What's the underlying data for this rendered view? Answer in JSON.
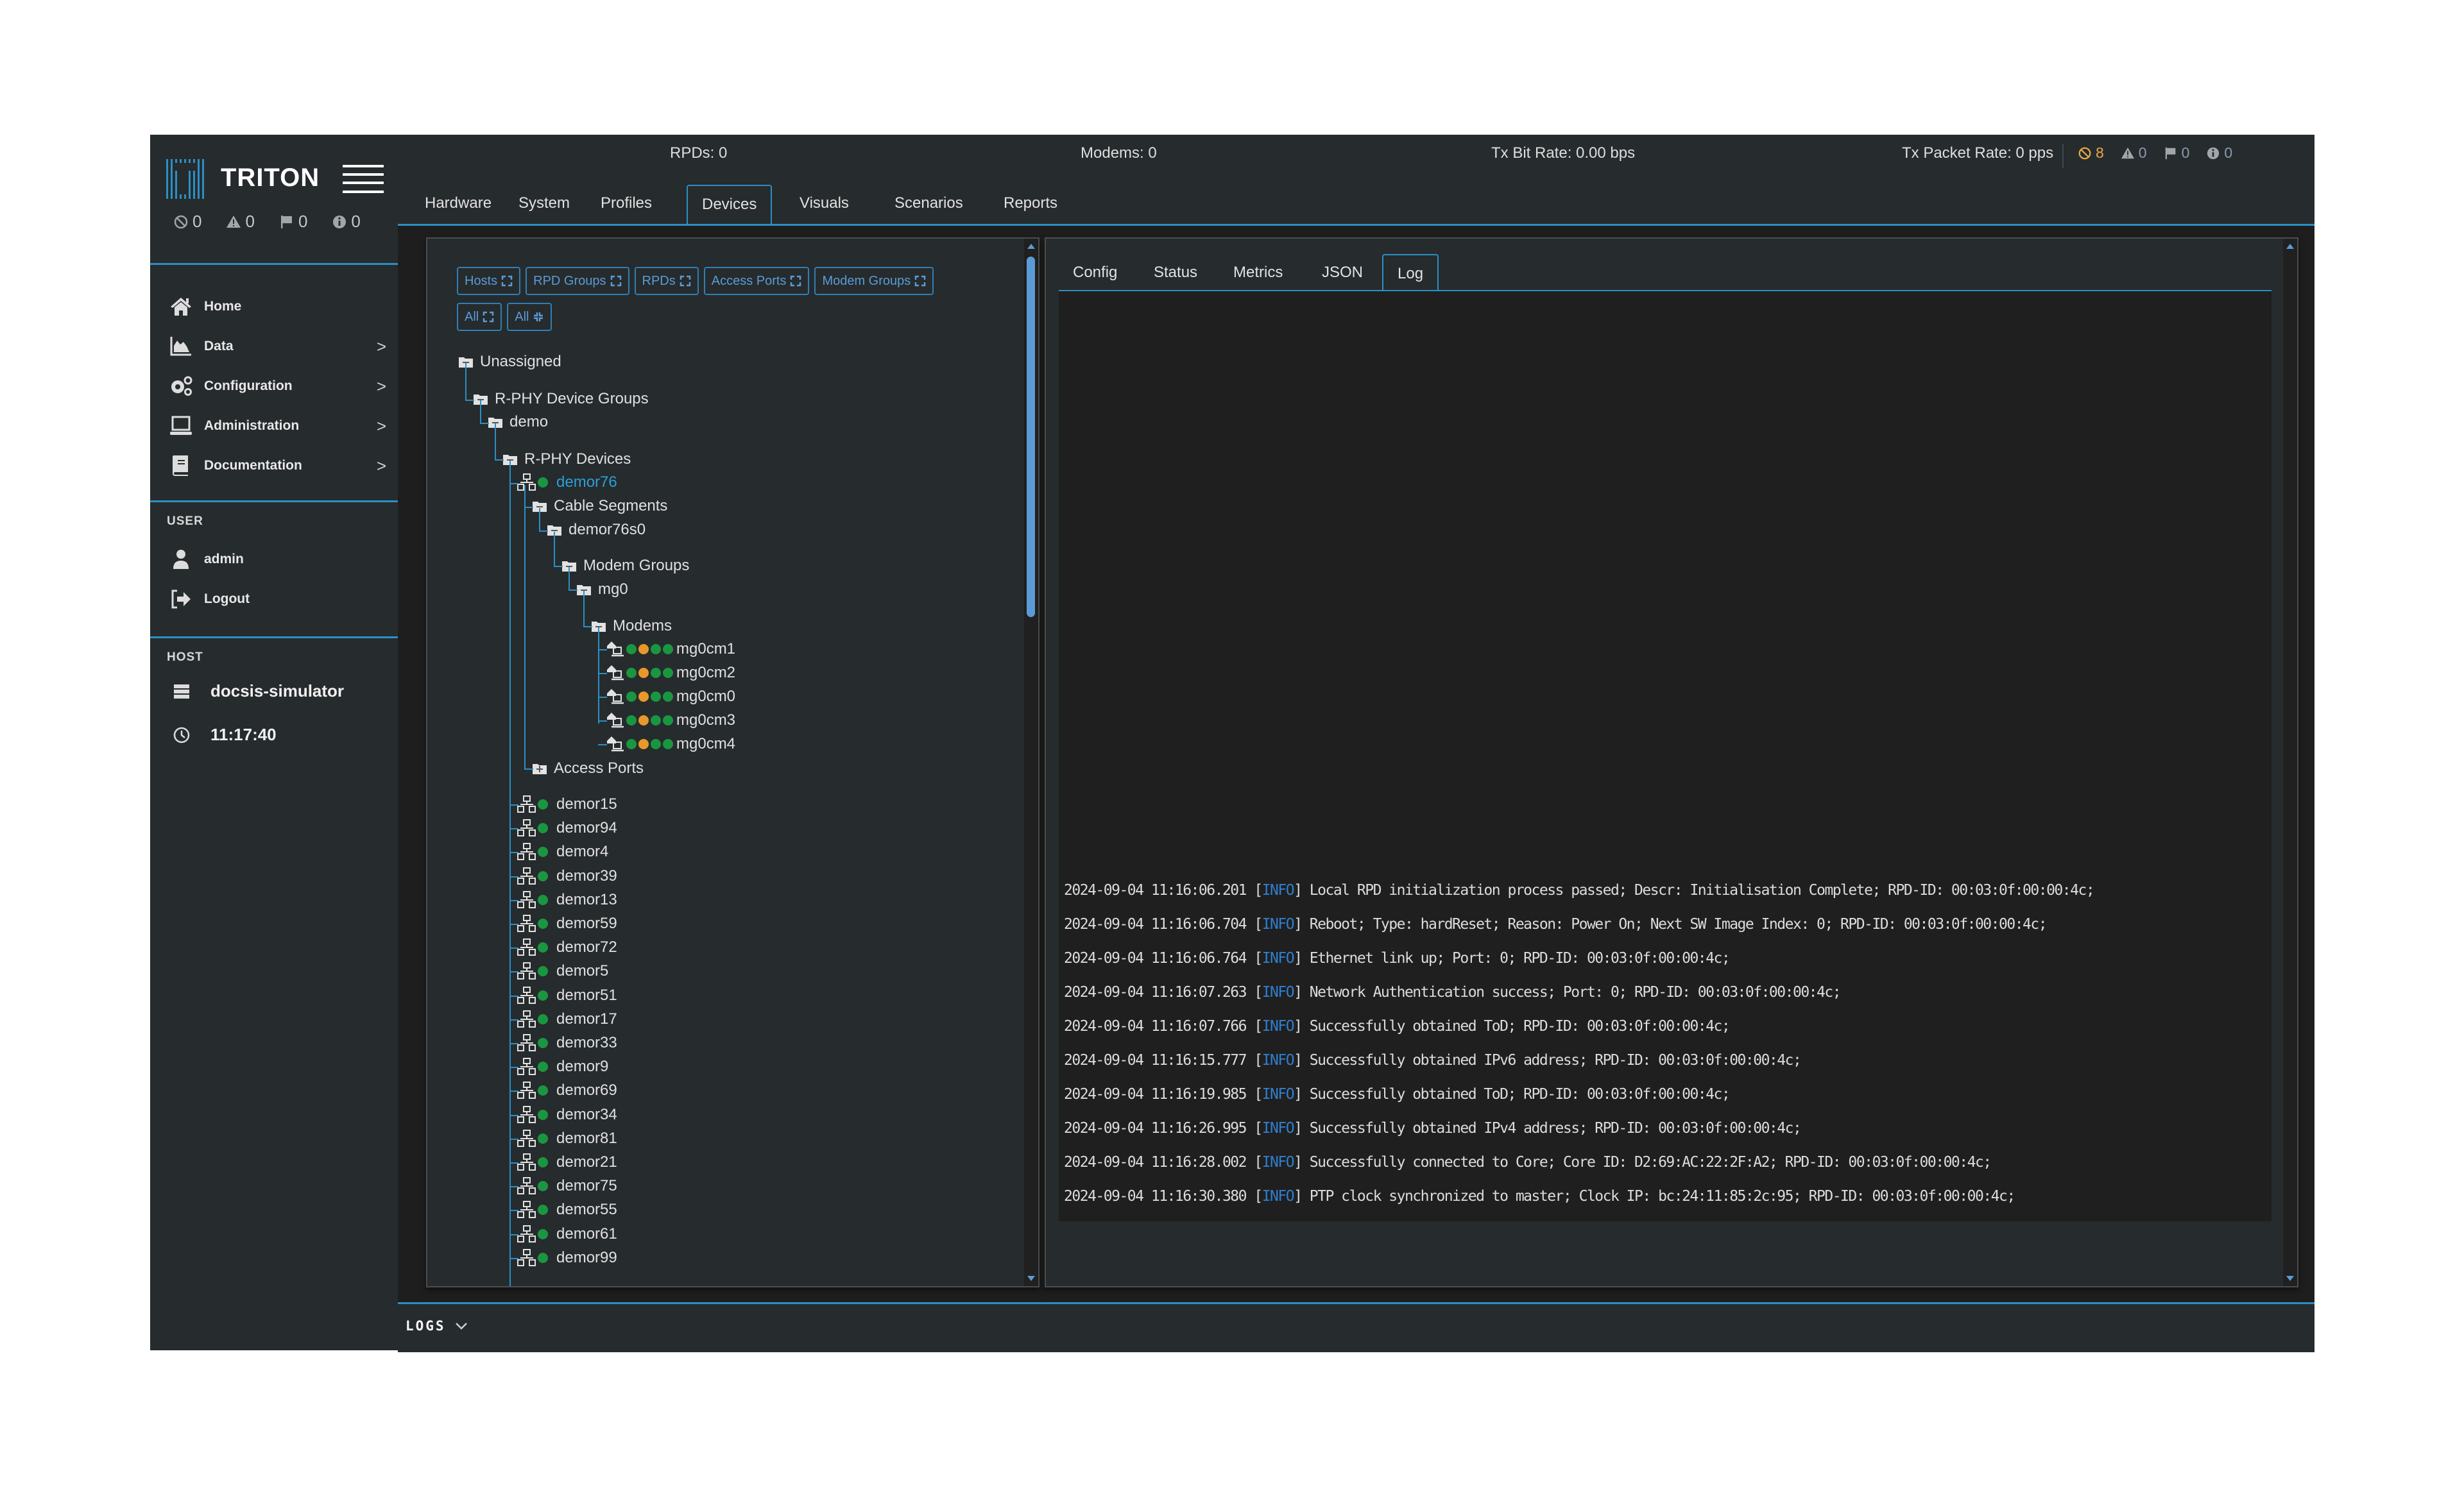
{
  "brand": {
    "name": "TRITON",
    "accent": "#2b8fc6"
  },
  "sidebar": {
    "counts": [
      {
        "icon": "blocked-icon",
        "value": "0"
      },
      {
        "icon": "warning-icon",
        "value": "0"
      },
      {
        "icon": "flag-icon",
        "value": "0"
      },
      {
        "icon": "info-icon",
        "value": "0"
      }
    ],
    "nav": [
      {
        "icon": "home-icon",
        "label": "Home",
        "has_submenu": false
      },
      {
        "icon": "chart-area-icon",
        "label": "Data",
        "has_submenu": true
      },
      {
        "icon": "gears-icon",
        "label": "Configuration",
        "has_submenu": true
      },
      {
        "icon": "laptop-icon",
        "label": "Administration",
        "has_submenu": true
      },
      {
        "icon": "book-icon",
        "label": "Documentation",
        "has_submenu": true
      }
    ],
    "chevron": ">",
    "user_heading": "USER",
    "user": {
      "name": "admin",
      "logout": "Logout"
    },
    "host_heading": "HOST",
    "host": {
      "name": "docsis-simulator",
      "time": "11:17:40"
    }
  },
  "header": {
    "stats": {
      "rpds": "RPDs: 0",
      "modems": "Modems: 0",
      "tx_bit_rate": "Tx Bit Rate: 0.00 bps",
      "tx_packet_rate": "Tx Packet Rate: 0 pps"
    },
    "counts": [
      {
        "icon": "blocked-icon",
        "value": "8",
        "color": "#e8a848"
      },
      {
        "icon": "warning-icon",
        "value": "0",
        "color": "#8a9ab0"
      },
      {
        "icon": "flag-icon",
        "value": "0",
        "color": "#8a9ab0"
      },
      {
        "icon": "info-icon",
        "value": "0",
        "color": "#8a9ab0"
      }
    ],
    "tabs": [
      "Hardware",
      "System",
      "Profiles",
      "Devices",
      "Visuals",
      "Scenarios",
      "Reports"
    ],
    "active_tab": "Devices"
  },
  "tree_panel": {
    "filters": [
      {
        "label": "Hosts",
        "action": "expand"
      },
      {
        "label": "RPD Groups",
        "action": "expand"
      },
      {
        "label": "RPDs",
        "action": "expand"
      },
      {
        "label": "Access Ports",
        "action": "expand"
      },
      {
        "label": "Modem Groups",
        "action": "expand"
      },
      {
        "label": "All",
        "action": "expand"
      },
      {
        "label": "All",
        "action": "collapse"
      }
    ],
    "nodes": {
      "unassigned": "Unassigned",
      "rphy_groups": "R-PHY Device Groups",
      "demo": "demo",
      "rphy_devices": "R-PHY Devices",
      "selected_device": "demor76",
      "cable_segments": "Cable Segments",
      "segment": "demor76s0",
      "modem_groups": "Modem Groups",
      "mg0": "mg0",
      "modems_folder": "Modems",
      "access_ports": "Access Ports"
    },
    "modems": [
      {
        "name": "mg0cm1",
        "status": [
          "green",
          "orange",
          "green",
          "green"
        ]
      },
      {
        "name": "mg0cm2",
        "status": [
          "green",
          "orange",
          "green",
          "green"
        ]
      },
      {
        "name": "mg0cm0",
        "status": [
          "green",
          "orange",
          "green",
          "green"
        ]
      },
      {
        "name": "mg0cm3",
        "status": [
          "green",
          "orange",
          "green",
          "green"
        ]
      },
      {
        "name": "mg0cm4",
        "status": [
          "green",
          "orange",
          "green",
          "green"
        ]
      }
    ],
    "devices": [
      "demor15",
      "demor94",
      "demor4",
      "demor39",
      "demor13",
      "demor59",
      "demor72",
      "demor5",
      "demor51",
      "demor17",
      "demor33",
      "demor9",
      "demor69",
      "demor34",
      "demor81",
      "demor21",
      "demor75",
      "demor55",
      "demor61",
      "demor99"
    ],
    "status_colors": {
      "green": "#1a9641",
      "orange": "#e8982a"
    }
  },
  "detail_panel": {
    "tabs": [
      "Config",
      "Status",
      "Metrics",
      "JSON",
      "Log"
    ],
    "active_tab": "Log",
    "log": [
      {
        "ts": "2024-09-04 11:16:06.201",
        "level": "INFO",
        "msg": "Local RPD initialization process passed; Descr: Initialisation Complete; RPD-ID: 00:03:0f:00:00:4c;"
      },
      {
        "ts": "2024-09-04 11:16:06.704",
        "level": "INFO",
        "msg": "Reboot; Type: hardReset; Reason: Power On; Next SW Image Index: 0; RPD-ID: 00:03:0f:00:00:4c;"
      },
      {
        "ts": "2024-09-04 11:16:06.764",
        "level": "INFO",
        "msg": "Ethernet link up; Port: 0; RPD-ID: 00:03:0f:00:00:4c;"
      },
      {
        "ts": "2024-09-04 11:16:07.263",
        "level": "INFO",
        "msg": "Network Authentication success; Port: 0; RPD-ID: 00:03:0f:00:00:4c;"
      },
      {
        "ts": "2024-09-04 11:16:07.766",
        "level": "INFO",
        "msg": "Successfully obtained ToD; RPD-ID: 00:03:0f:00:00:4c;"
      },
      {
        "ts": "2024-09-04 11:16:15.777",
        "level": "INFO",
        "msg": "Successfully obtained IPv6 address; RPD-ID: 00:03:0f:00:00:4c;"
      },
      {
        "ts": "2024-09-04 11:16:19.985",
        "level": "INFO",
        "msg": "Successfully obtained ToD; RPD-ID: 00:03:0f:00:00:4c;"
      },
      {
        "ts": "2024-09-04 11:16:26.995",
        "level": "INFO",
        "msg": "Successfully obtained IPv4 address; RPD-ID: 00:03:0f:00:00:4c;"
      },
      {
        "ts": "2024-09-04 11:16:28.002",
        "level": "INFO",
        "msg": "Successfully connected to Core; Core ID: D2:69:AC:22:2F:A2; RPD-ID: 00:03:0f:00:00:4c;"
      },
      {
        "ts": "2024-09-04 11:16:30.380",
        "level": "INFO",
        "msg": "PTP clock synchronized to master; Clock IP: bc:24:11:85:2c:95; RPD-ID: 00:03:0f:00:00:4c;"
      }
    ]
  },
  "footer": {
    "logs_label": "LOGS"
  }
}
